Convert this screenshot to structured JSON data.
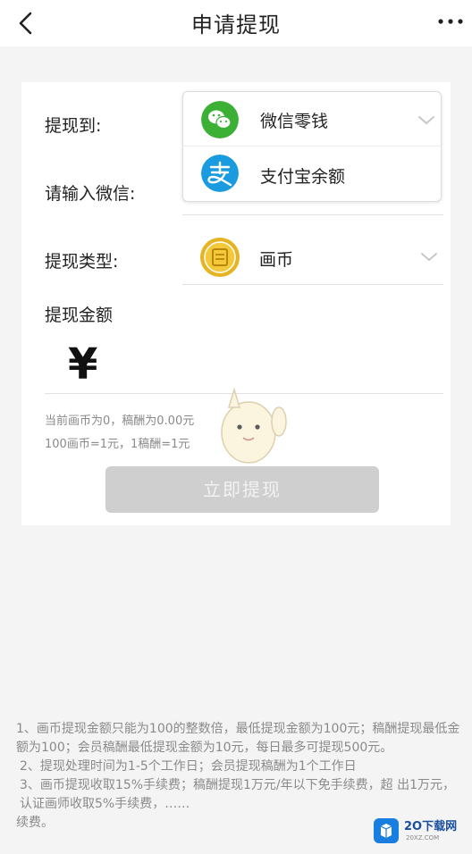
{
  "header": {
    "title": "申请提现"
  },
  "form": {
    "withdraw_to_label": "提现到:",
    "wechat_input_label": "请输入微信:",
    "withdraw_type_label": "提现类型:",
    "amount_label": "提现金额",
    "currency_symbol": "¥",
    "type_value": "画币"
  },
  "dropdown": {
    "options": [
      {
        "label": "微信零钱",
        "icon": "wechat-icon",
        "color": "#3cb034"
      },
      {
        "label": "支付宝余额",
        "icon": "alipay-icon",
        "color": "#1a9be0"
      }
    ]
  },
  "info": {
    "balance": "当前画币为0，稿酬为0.00元",
    "rate": "100画币=1元，1稿酬=1元"
  },
  "submit_button": "立即提现",
  "rules": [
    "1、画币提现金额只能为100的整数倍，最低提现金额为100元；稿酬提现最低金额为100；会员稿酬最低提现金额为10元，每日最多可提现500元。",
    "2、提现处理时间为1-5个工作日；会员提现稿酬为1个工作日",
    "3、画币提现收取15%手续费；稿酬提现1万元/年以下免手续费，超 出1万元，认证画师收取5%手续费，……",
    "续费。"
  ],
  "watermark": {
    "brand": "2O下载网",
    "sub": "20XZ.COM"
  },
  "colors": {
    "wechat_green": "#3cb034",
    "alipay_blue": "#1a9be0",
    "coin_gold": "#e6b422",
    "button_disabled": "#cfcfcf"
  }
}
